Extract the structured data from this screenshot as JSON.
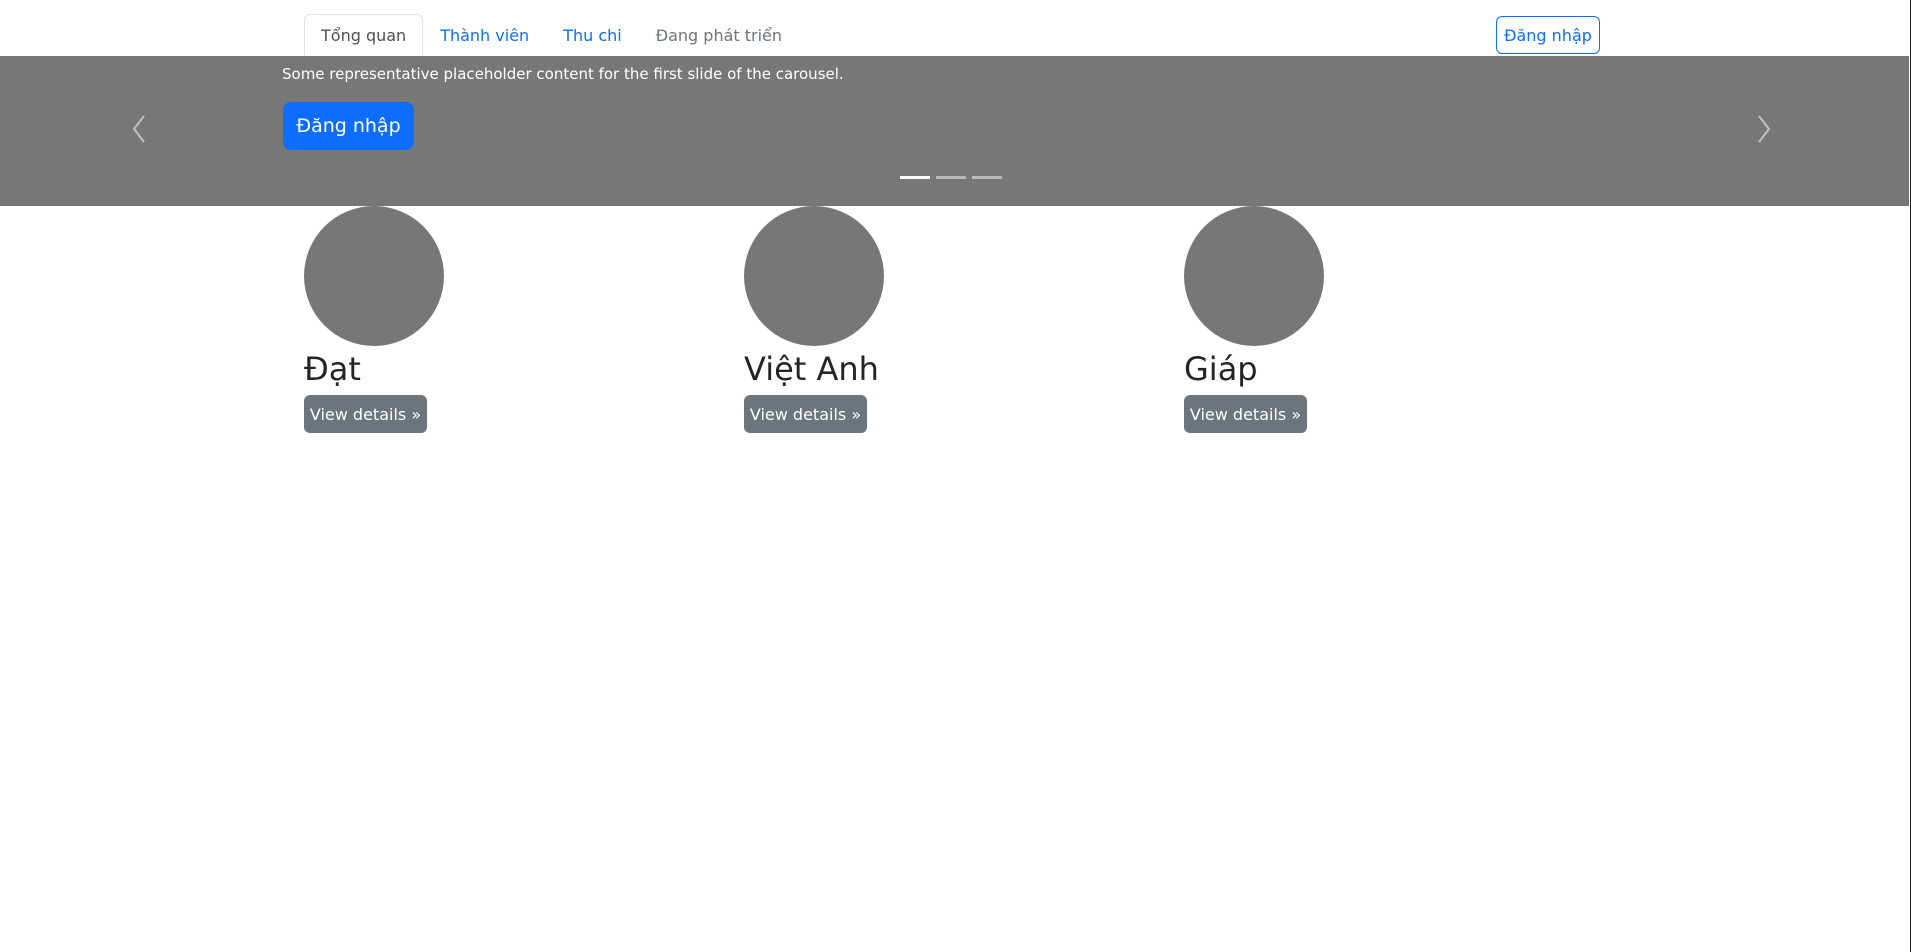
{
  "nav": {
    "tabs": [
      {
        "label": "Tổng quan",
        "active": true
      },
      {
        "label": "Thành viên"
      },
      {
        "label": "Thu chi"
      },
      {
        "label": "Đang phát triển"
      }
    ],
    "login_label": "Đăng nhập"
  },
  "carousel": {
    "caption": "Some representative placeholder content for the first slide of the carousel.",
    "button_label": "Đăng nhập",
    "active_slide": 1,
    "slide_count": 3
  },
  "members": [
    {
      "name": "Đạt",
      "button_label": "View details »"
    },
    {
      "name": "Việt Anh",
      "button_label": "View details »"
    },
    {
      "name": "Giáp",
      "button_label": "View details »"
    }
  ],
  "colors": {
    "primary": "#0d6efd",
    "secondary": "#6c757d",
    "placeholder": "#777777"
  }
}
